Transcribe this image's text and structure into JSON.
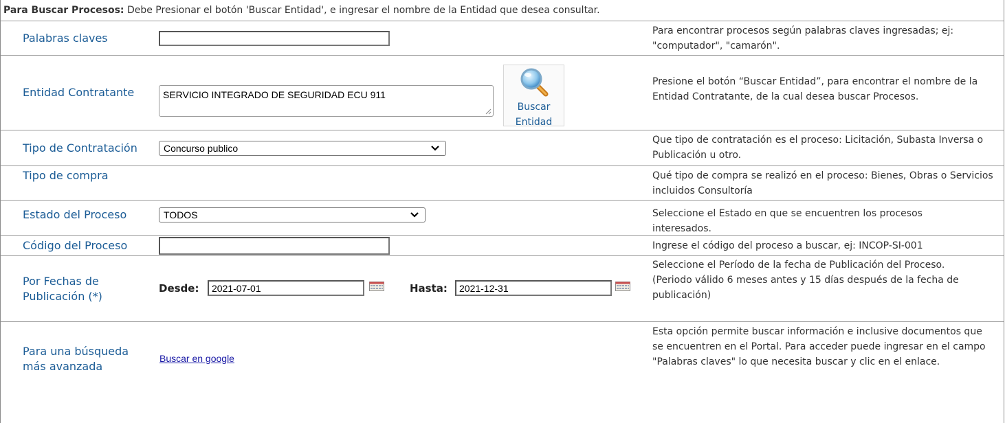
{
  "info": {
    "lead": "Para Buscar Procesos:",
    "text": " Debe Presionar el botón 'Buscar Entidad', e ingresar el nombre de la Entidad que desea consultar."
  },
  "rows": {
    "keywords": {
      "label": "Palabras claves",
      "value": "",
      "help": "Para encontrar procesos según palabras claves ingresadas; ej: \"computador\", \"camarón\"."
    },
    "entity": {
      "label": "Entidad Contratante",
      "value": "SERVICIO INTEGRADO DE SEGURIDAD ECU 911",
      "button_line1": "Buscar",
      "button_line2": "Entidad",
      "button_icon": "magnifier-icon",
      "help": "Presione el botón “Buscar Entidad”, para encontrar el nombre de la Entidad Contratante, de la cual desea buscar Procesos."
    },
    "contract_type": {
      "label": "Tipo de Contratación",
      "selected": "Concurso publico",
      "help": "Que tipo de contratación es el proceso: Licitación, Subasta Inversa o Publicación u otro."
    },
    "purchase_type": {
      "label": "Tipo de compra",
      "help": "Qué tipo de compra se realizó en el proceso: Bienes, Obras o Servicios incluidos Consultoría"
    },
    "status": {
      "label": "Estado del Proceso",
      "selected": "TODOS",
      "help": "Seleccione el Estado en que se encuentren los procesos interesados."
    },
    "code": {
      "label": "Código del Proceso",
      "value": "",
      "help": "Ingrese el código del proceso a buscar, ej: INCOP-SI-001"
    },
    "dates": {
      "label_line1": "Por Fechas de",
      "label_line2": "Publicación (*)",
      "from_label": "Desde:",
      "from_value": "2021-07-01",
      "to_label": "Hasta:",
      "to_value": "2021-12-31",
      "help_line1": "Seleccione el Período de la fecha de Publicación del Proceso.",
      "help_line2": "(Periodo válido 6 meses antes y 15 días después de la fecha de publicación)"
    },
    "advanced": {
      "label_line1": "Para una búsqueda",
      "label_line2": "más avanzada",
      "link": "Buscar en google",
      "help": "Esta opción permite buscar información e inclusive documentos que se encuentren en el Portal. Para acceder puede ingresar en el campo \"Palabras claves\" lo que necesita buscar y clic en el enlace."
    }
  },
  "colors": {
    "label": "#1b5c96",
    "text": "#333333",
    "link": "#1a1aa6",
    "border": "#9a9a9a"
  }
}
